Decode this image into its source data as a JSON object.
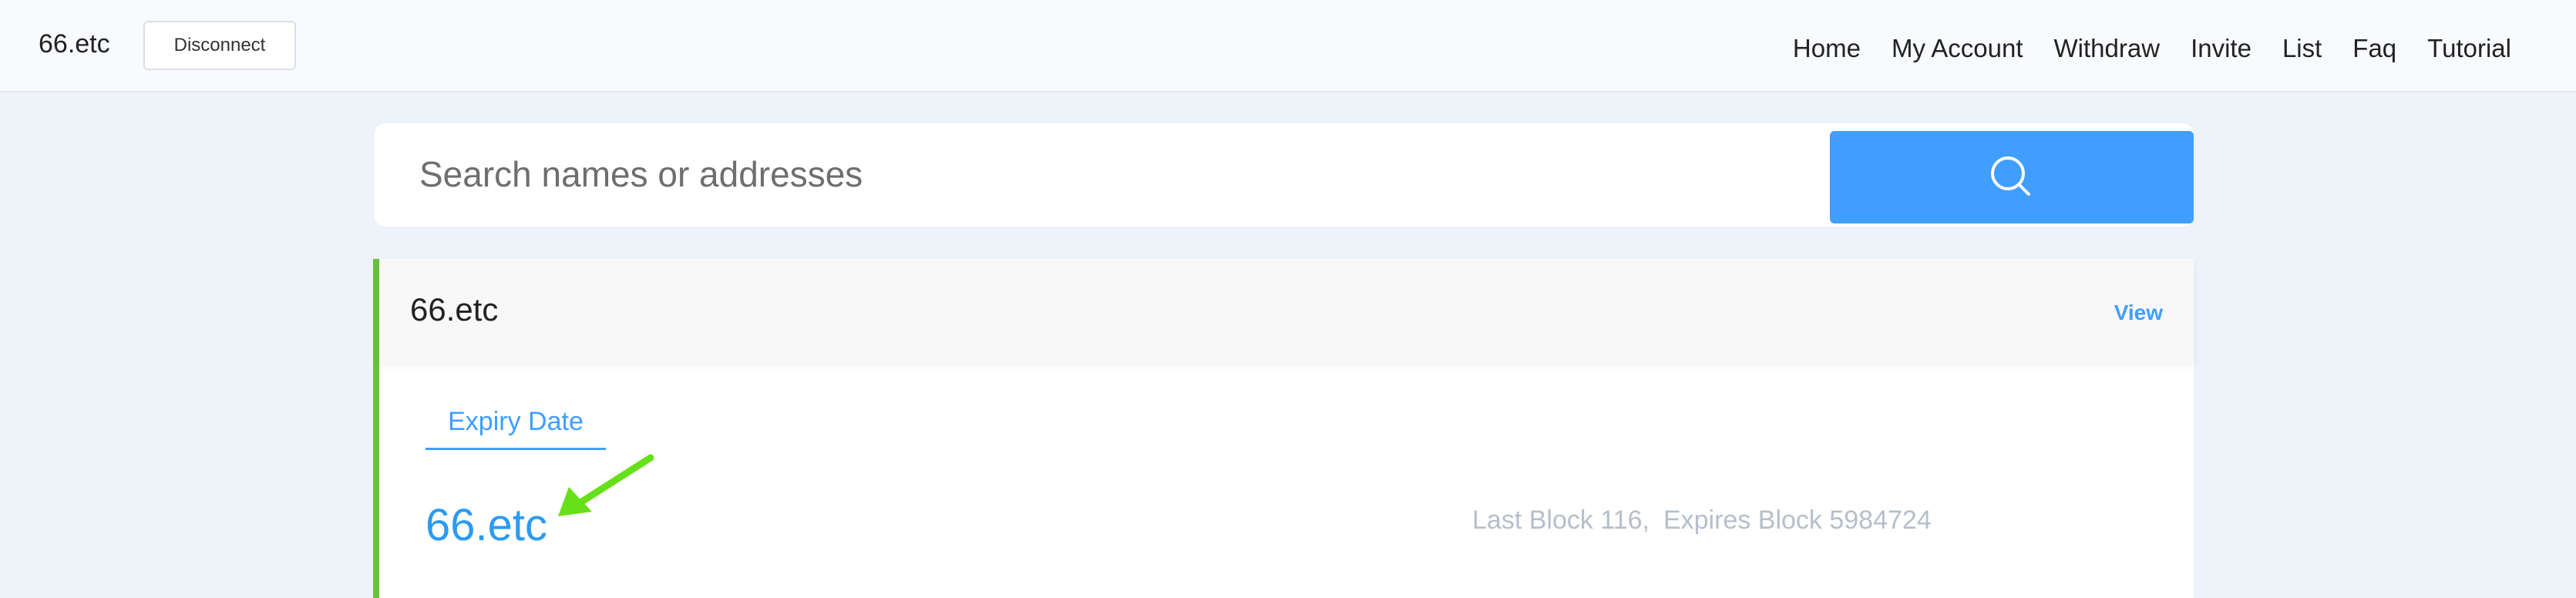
{
  "header": {
    "brand": "66.etc",
    "disconnect_label": "Disconnect",
    "nav": [
      {
        "label": "Home"
      },
      {
        "label": "My Account"
      },
      {
        "label": "Withdraw"
      },
      {
        "label": "Invite"
      },
      {
        "label": "List"
      },
      {
        "label": "Faq"
      },
      {
        "label": "Tutorial"
      }
    ]
  },
  "search": {
    "placeholder": "Search names or addresses",
    "value": "",
    "button_icon": "search-icon"
  },
  "result": {
    "title": "66.etc",
    "view_label": "View",
    "tab_label": "Expiry Date",
    "domain": "66.etc",
    "last_block": "Last Block 116,",
    "expires_block": "Expires Block 5984724"
  },
  "colors": {
    "accent": "#409eff",
    "card_border": "#67c23a",
    "annotation_arrow": "#66e018"
  }
}
